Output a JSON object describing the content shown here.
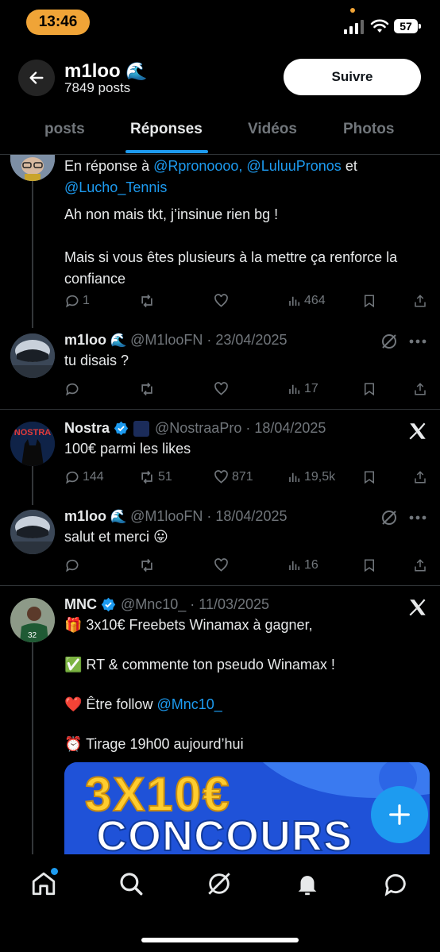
{
  "status_bar": {
    "time": "13:46",
    "battery": "57"
  },
  "header": {
    "name": "m1loo",
    "name_emoji": "🌊",
    "posts_count": "7849 posts",
    "follow_label": "Suivre"
  },
  "tabs": [
    {
      "label": "posts",
      "active": false
    },
    {
      "label": "Réponses",
      "active": true
    },
    {
      "label": "Vidéos",
      "active": false
    },
    {
      "label": "Photos",
      "active": false
    }
  ],
  "tweets": [
    {
      "reply_prefix": "En réponse à",
      "reply_mentions_1": "@Rpronoooo, @LuluuPronos",
      "reply_and": "et",
      "reply_mentions_2": "@Lucho_Tennis",
      "line1": "Ah non mais tkt, j’insinue rien bg !",
      "line2": "Mais si vous êtes plusieurs à la mettre ça renforce la",
      "line3": "confiance",
      "replies": "1",
      "retweets": "",
      "likes": "",
      "views": "464"
    },
    {
      "name": "m1loo",
      "emoji": "🌊",
      "handle_date": "@M1looFN · 23/04/2025",
      "text": "tu disais ?",
      "replies": "",
      "retweets": "",
      "likes": "",
      "views": "17"
    },
    {
      "name": "Nostra",
      "handle_date": "@NostraaPro · 18/04/2025",
      "text": "100€ parmi les likes",
      "avatar_text": "NOSTRA",
      "replies": "144",
      "retweets": "51",
      "likes": "871",
      "views": "19,5k"
    },
    {
      "name": "m1loo",
      "emoji": "🌊",
      "handle_date": "@M1looFN · 18/04/2025",
      "text": "salut et merci 😛",
      "replies": "",
      "retweets": "",
      "likes": "",
      "views": "16"
    },
    {
      "name": "MNC",
      "handle_date": "@Mnc10_ · 11/03/2025",
      "line1": "🎁 3x10€ Freebets Winamax à gagner,",
      "line2": "✅ RT & commente ton pseudo Winamax !",
      "line3_prefix": "❤️ Être follow",
      "line3_mention": "@Mnc10_",
      "line4": "⏰ Tirage 19h00 aujourd’hui",
      "image_text_1": "3X10€",
      "image_text_2": "CONCOURS"
    }
  ],
  "colors": {
    "background": "#000000",
    "accent": "#1d9bf0",
    "muted": "#71767b",
    "status_pill": "#f0a437"
  }
}
